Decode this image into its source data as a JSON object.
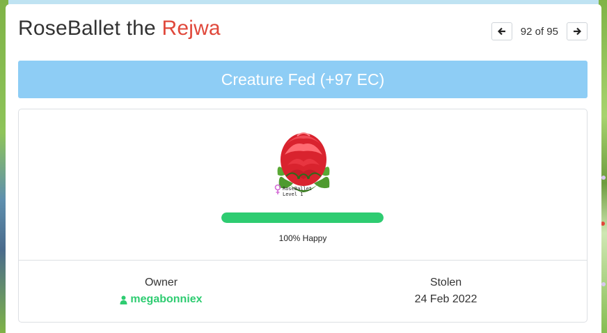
{
  "header": {
    "name": "RoseBallet the ",
    "species": "Rejwa"
  },
  "pager": {
    "text": "92 of 95",
    "prev_icon": "arrow-left-icon",
    "next_icon": "arrow-right-icon"
  },
  "banner": {
    "text": "Creature Fed (+97 EC)",
    "color": "#8ecdf5"
  },
  "creature": {
    "caption_name": "RoseBallet",
    "caption_level": "Level 1",
    "gender_icon": "female-icon"
  },
  "happiness": {
    "percent": 100,
    "label": "100% Happy",
    "color": "#2ecc71"
  },
  "info": {
    "owner_label": "Owner",
    "owner_name": "megabonniex",
    "owner_icon": "user-icon",
    "stolen_label": "Stolen",
    "stolen_date": "24 Feb 2022"
  },
  "colors": {
    "accent_red": "#e0483b",
    "accent_green": "#2ecc71"
  }
}
